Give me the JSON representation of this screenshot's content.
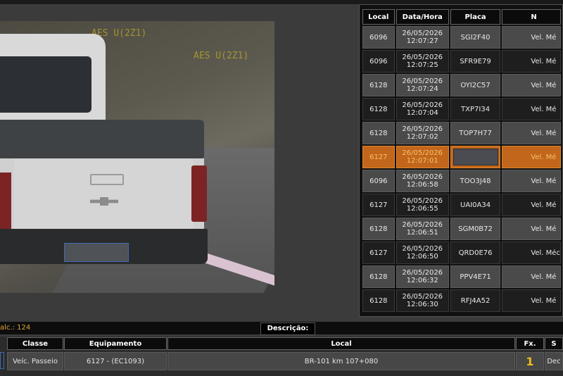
{
  "camera": {
    "overlay_top": "AES U(2Z1)",
    "overlay_mid": "AES U(2Z1)"
  },
  "table": {
    "headers": [
      "Local",
      "Data/Hora",
      "Placa",
      "N"
    ],
    "rows": [
      {
        "local": "6096",
        "date": "26/05/2026",
        "time": "12:07:27",
        "placa": "SGI2F40",
        "n": "Vel. Mé"
      },
      {
        "local": "6096",
        "date": "26/05/2026",
        "time": "12:07:25",
        "placa": "SFR9E79",
        "n": "Vel. Mé"
      },
      {
        "local": "6128",
        "date": "26/05/2026",
        "time": "12:07:24",
        "placa": "OYI2C57",
        "n": "Vel. Mé"
      },
      {
        "local": "6128",
        "date": "26/05/2026",
        "time": "12:07:04",
        "placa": "TXP7I34",
        "n": "Vel. Mé"
      },
      {
        "local": "6128",
        "date": "26/05/2026",
        "time": "12:07:02",
        "placa": "TOP7H77",
        "n": "Vel. Mé"
      },
      {
        "local": "6127",
        "date": "26/05/2026",
        "time": "12:07:01",
        "placa": "",
        "n": "Vel. Mé",
        "selected": true
      },
      {
        "local": "6096",
        "date": "26/05/2026",
        "time": "12:06:58",
        "placa": "TOO3J48",
        "n": "Vel. Mé"
      },
      {
        "local": "6127",
        "date": "26/05/2026",
        "time": "12:06:55",
        "placa": "UAI0A34",
        "n": "Vel. Mé"
      },
      {
        "local": "6128",
        "date": "26/05/2026",
        "time": "12:06:51",
        "placa": "SGM0B72",
        "n": "Vel. Mé"
      },
      {
        "local": "6127",
        "date": "26/05/2026",
        "time": "12:06:50",
        "placa": "QRD0E76",
        "n": "Vel. Méc"
      },
      {
        "local": "6128",
        "date": "26/05/2026",
        "time": "12:06:32",
        "placa": "PPV4E71",
        "n": "Vel. Mé"
      },
      {
        "local": "6128",
        "date": "26/05/2026",
        "time": "12:06:30",
        "placa": "RFJ4A52",
        "n": "Vel. Mé"
      }
    ]
  },
  "status": {
    "calc": "alc.: 124",
    "descricao_label": "Descrição:"
  },
  "footer": {
    "headers": {
      "classe": "Classe",
      "equipamento": "Equipamento",
      "local": "Local",
      "fx": "Fx.",
      "s": "S"
    },
    "values": {
      "classe": "Veíc. Passeio",
      "equipamento": "6127 - (EC1093)",
      "local": "BR-101 km 107+080",
      "fx": "1",
      "s": "Dec"
    }
  },
  "colors": {
    "selected_row": "#c2661c",
    "accent_text": "#f2b81e"
  }
}
